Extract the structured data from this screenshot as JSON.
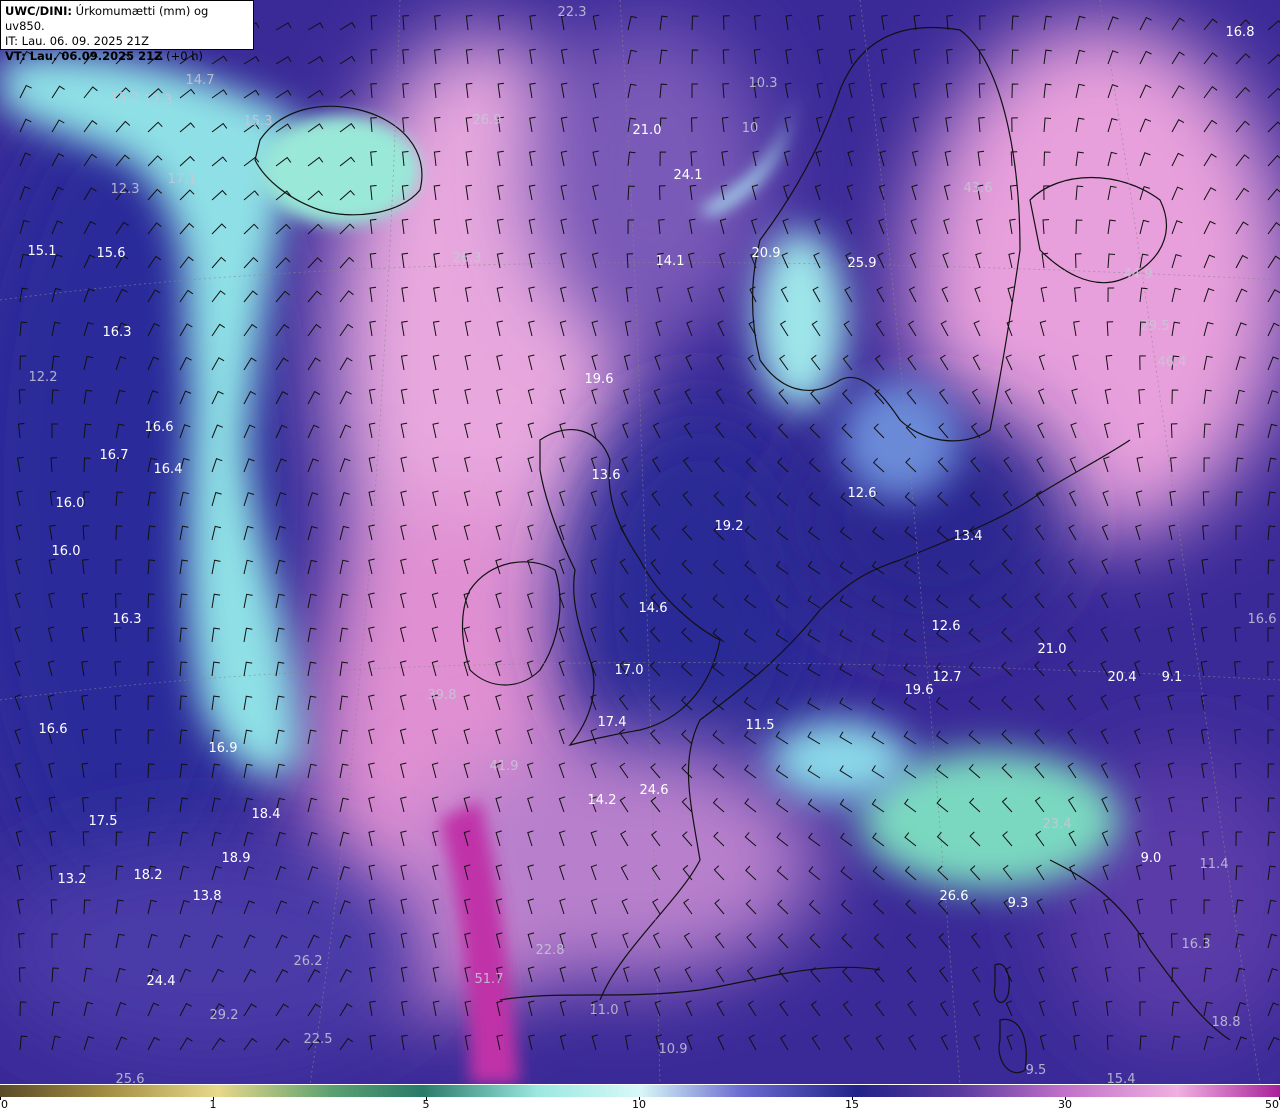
{
  "header": {
    "model": "UWC/DINI:",
    "title": "Úrkomumætti (mm) og uv850.",
    "it_line": "IT: Lau. 06. 09. 2025 21Z",
    "vt_label": "VT: Lau. 06.09.2025 21Z",
    "vt_offset": "(+0 h)"
  },
  "colorbar": {
    "ticks": [
      "0",
      "1",
      "5",
      "10",
      "15",
      "30",
      "50"
    ],
    "colors": [
      "#5a4a28",
      "#a08a40",
      "#e8d88a",
      "#5aa070",
      "#2a7a6a",
      "#9ae8e0",
      "#d8f8f8",
      "#6a6ad0",
      "#222288",
      "#5a3aa0",
      "#c070c8",
      "#f0b0e0",
      "#a8209a"
    ]
  },
  "map": {
    "labels": [
      {
        "v": "22.3",
        "dim": true
      },
      {
        "v": "16.8",
        "dim": false
      },
      {
        "v": "14.7",
        "dim": true
      },
      {
        "v": "15.2",
        "dim": true
      },
      {
        "v": "12.3",
        "dim": true
      },
      {
        "v": "10.3",
        "dim": true
      },
      {
        "v": "10",
        "dim": true
      },
      {
        "v": "15.3",
        "dim": true
      },
      {
        "v": "26.9",
        "dim": true
      },
      {
        "v": "21.0",
        "dim": false
      },
      {
        "v": "17.1",
        "dim": true
      },
      {
        "v": "24.1",
        "dim": false
      },
      {
        "v": "43.6",
        "dim": true
      },
      {
        "v": "12.3",
        "dim": true
      },
      {
        "v": "15.1",
        "dim": false
      },
      {
        "v": "15.6",
        "dim": false
      },
      {
        "v": "26.3",
        "dim": true
      },
      {
        "v": "14.1",
        "dim": false
      },
      {
        "v": "20.9",
        "dim": false
      },
      {
        "v": "25.9",
        "dim": false
      },
      {
        "v": "44.9",
        "dim": true
      },
      {
        "v": "16.3",
        "dim": false
      },
      {
        "v": "29.5",
        "dim": true
      },
      {
        "v": "46.4",
        "dim": true
      },
      {
        "v": "12.2",
        "dim": true
      },
      {
        "v": "19.6",
        "dim": false
      },
      {
        "v": "16.6",
        "dim": false
      },
      {
        "v": "16.7",
        "dim": false
      },
      {
        "v": "16.4",
        "dim": false
      },
      {
        "v": "13.6",
        "dim": false
      },
      {
        "v": "12.6",
        "dim": false
      },
      {
        "v": "13.4",
        "dim": false
      },
      {
        "v": "16.0",
        "dim": false
      },
      {
        "v": "19.2",
        "dim": false
      },
      {
        "v": "16.0",
        "dim": false
      },
      {
        "v": "14.6",
        "dim": false
      },
      {
        "v": "12.6",
        "dim": false
      },
      {
        "v": "16.3",
        "dim": false
      },
      {
        "v": "21.0",
        "dim": false
      },
      {
        "v": "20.4",
        "dim": false
      },
      {
        "v": "9.1",
        "dim": false
      },
      {
        "v": "17.0",
        "dim": false
      },
      {
        "v": "12.7",
        "dim": false
      },
      {
        "v": "19.6",
        "dim": false
      },
      {
        "v": "39.8",
        "dim": true
      },
      {
        "v": "16.6",
        "dim": false
      },
      {
        "v": "16.9",
        "dim": false
      },
      {
        "v": "17.4",
        "dim": false
      },
      {
        "v": "11.5",
        "dim": false
      },
      {
        "v": "41.9",
        "dim": true
      },
      {
        "v": "14.2",
        "dim": false
      },
      {
        "v": "24.6",
        "dim": false
      },
      {
        "v": "17.5",
        "dim": false
      },
      {
        "v": "18.4",
        "dim": false
      },
      {
        "v": "18.9",
        "dim": false
      },
      {
        "v": "23.4",
        "dim": true
      },
      {
        "v": "13.2",
        "dim": false
      },
      {
        "v": "18.2",
        "dim": false
      },
      {
        "v": "13.8",
        "dim": false
      },
      {
        "v": "9.0",
        "dim": false
      },
      {
        "v": "11.4",
        "dim": true
      },
      {
        "v": "26.6",
        "dim": false
      },
      {
        "v": "9.3",
        "dim": false
      },
      {
        "v": "22.8",
        "dim": true
      },
      {
        "v": "26.2",
        "dim": true
      },
      {
        "v": "24.4",
        "dim": false
      },
      {
        "v": "51.7",
        "dim": true
      },
      {
        "v": "29.2",
        "dim": true
      },
      {
        "v": "11.0",
        "dim": true
      },
      {
        "v": "22.5",
        "dim": true
      },
      {
        "v": "10.9",
        "dim": true
      },
      {
        "v": "25.6",
        "dim": true
      },
      {
        "v": "15.4",
        "dim": true
      },
      {
        "v": "9.5",
        "dim": true
      },
      {
        "v": "16.6",
        "dim": true
      },
      {
        "v": "18.8",
        "dim": true
      },
      {
        "v": "16.3",
        "dim": true
      }
    ]
  }
}
